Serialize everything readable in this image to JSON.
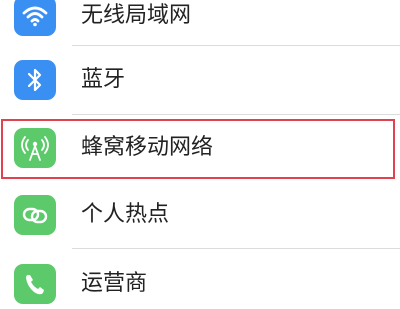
{
  "colors": {
    "wifi": "#3a8ff3",
    "bluetooth": "#3a8ff3",
    "cellular": "#5cc96b",
    "hotspot": "#5cc96b",
    "carrier": "#5cc96b",
    "highlight": "#e0434f"
  },
  "settings": {
    "items": [
      {
        "label": "无线局域网",
        "icon": "wifi-icon"
      },
      {
        "label": "蓝牙",
        "icon": "bluetooth-icon"
      },
      {
        "label": "蜂窝移动网络",
        "icon": "cellular-icon"
      },
      {
        "label": "个人热点",
        "icon": "hotspot-icon"
      },
      {
        "label": "运营商",
        "icon": "phone-icon"
      }
    ]
  }
}
